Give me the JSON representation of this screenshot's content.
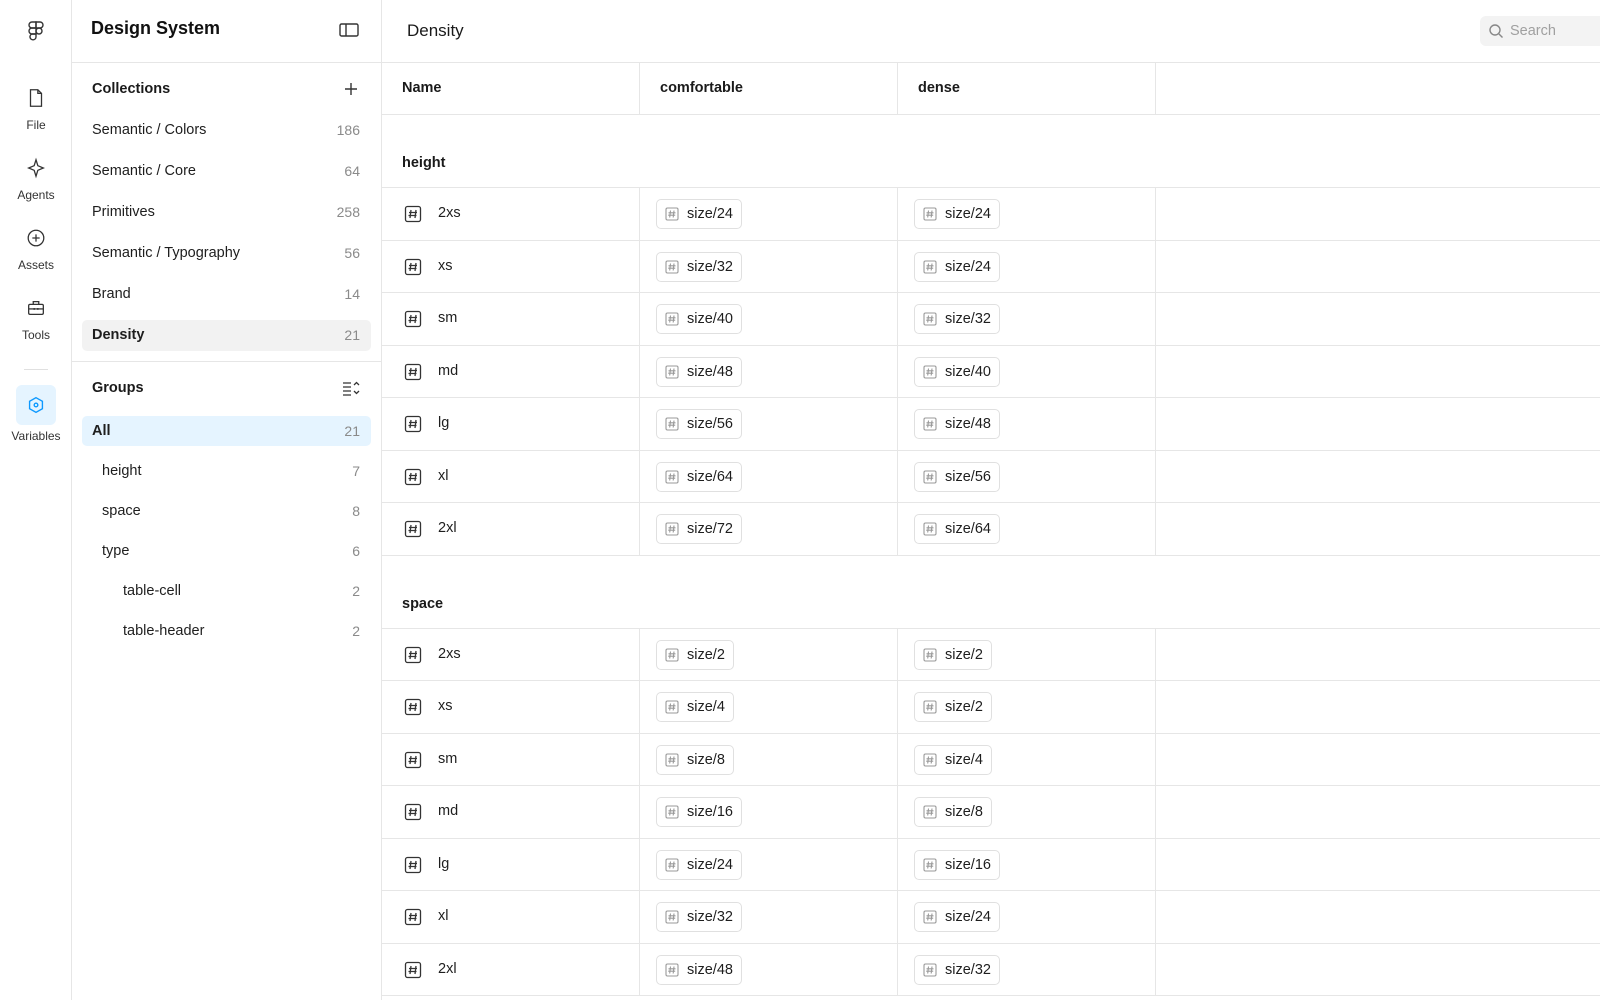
{
  "rail": {
    "logo_icon": "figma-logo-icon",
    "items": [
      {
        "label": "File",
        "icon": "file-icon"
      },
      {
        "label": "Agents",
        "icon": "sparkle-icon"
      },
      {
        "label": "Assets",
        "icon": "plus-circle-icon"
      },
      {
        "label": "Tools",
        "icon": "toolbox-icon"
      },
      {
        "label": "Variables",
        "icon": "variables-icon",
        "active": true
      }
    ]
  },
  "sidebar": {
    "title": "Design System",
    "collections_title": "Collections",
    "collections": [
      {
        "label": "Semantic / Colors",
        "count": "186"
      },
      {
        "label": "Semantic / Core",
        "count": "64"
      },
      {
        "label": "Primitives",
        "count": "258"
      },
      {
        "label": "Semantic / Typography",
        "count": "56"
      },
      {
        "label": "Brand",
        "count": "14"
      },
      {
        "label": "Density",
        "count": "21",
        "selected": true
      }
    ],
    "groups_title": "Groups",
    "groups": [
      {
        "label": "All",
        "count": "21",
        "level": 0,
        "active": true
      },
      {
        "label": "height",
        "count": "7",
        "level": 1
      },
      {
        "label": "space",
        "count": "8",
        "level": 1
      },
      {
        "label": "type",
        "count": "6",
        "level": 1
      },
      {
        "label": "table-cell",
        "count": "2",
        "level": 2
      },
      {
        "label": "table-header",
        "count": "2",
        "level": 2
      }
    ]
  },
  "main": {
    "title": "Density",
    "search_placeholder": "Search",
    "columns": [
      "Name",
      "comfortable",
      "dense"
    ],
    "groups": [
      {
        "name": "height",
        "rows": [
          {
            "name": "2xs",
            "comfortable": "size/24",
            "dense": "size/24"
          },
          {
            "name": "xs",
            "comfortable": "size/32",
            "dense": "size/24"
          },
          {
            "name": "sm",
            "comfortable": "size/40",
            "dense": "size/32"
          },
          {
            "name": "md",
            "comfortable": "size/48",
            "dense": "size/40"
          },
          {
            "name": "lg",
            "comfortable": "size/56",
            "dense": "size/48"
          },
          {
            "name": "xl",
            "comfortable": "size/64",
            "dense": "size/56"
          },
          {
            "name": "2xl",
            "comfortable": "size/72",
            "dense": "size/64"
          }
        ]
      },
      {
        "name": "space",
        "rows": [
          {
            "name": "2xs",
            "comfortable": "size/2",
            "dense": "size/2"
          },
          {
            "name": "xs",
            "comfortable": "size/4",
            "dense": "size/2"
          },
          {
            "name": "sm",
            "comfortable": "size/8",
            "dense": "size/4"
          },
          {
            "name": "md",
            "comfortable": "size/16",
            "dense": "size/8"
          },
          {
            "name": "lg",
            "comfortable": "size/24",
            "dense": "size/16"
          },
          {
            "name": "xl",
            "comfortable": "size/32",
            "dense": "size/24"
          },
          {
            "name": "2xl",
            "comfortable": "size/48",
            "dense": "size/32"
          }
        ]
      }
    ]
  },
  "colors": {
    "accent": "#0d99ff",
    "active_bg": "#e5f4ff",
    "selected_bg": "#f2f2f2",
    "border": "#e6e6e6"
  }
}
